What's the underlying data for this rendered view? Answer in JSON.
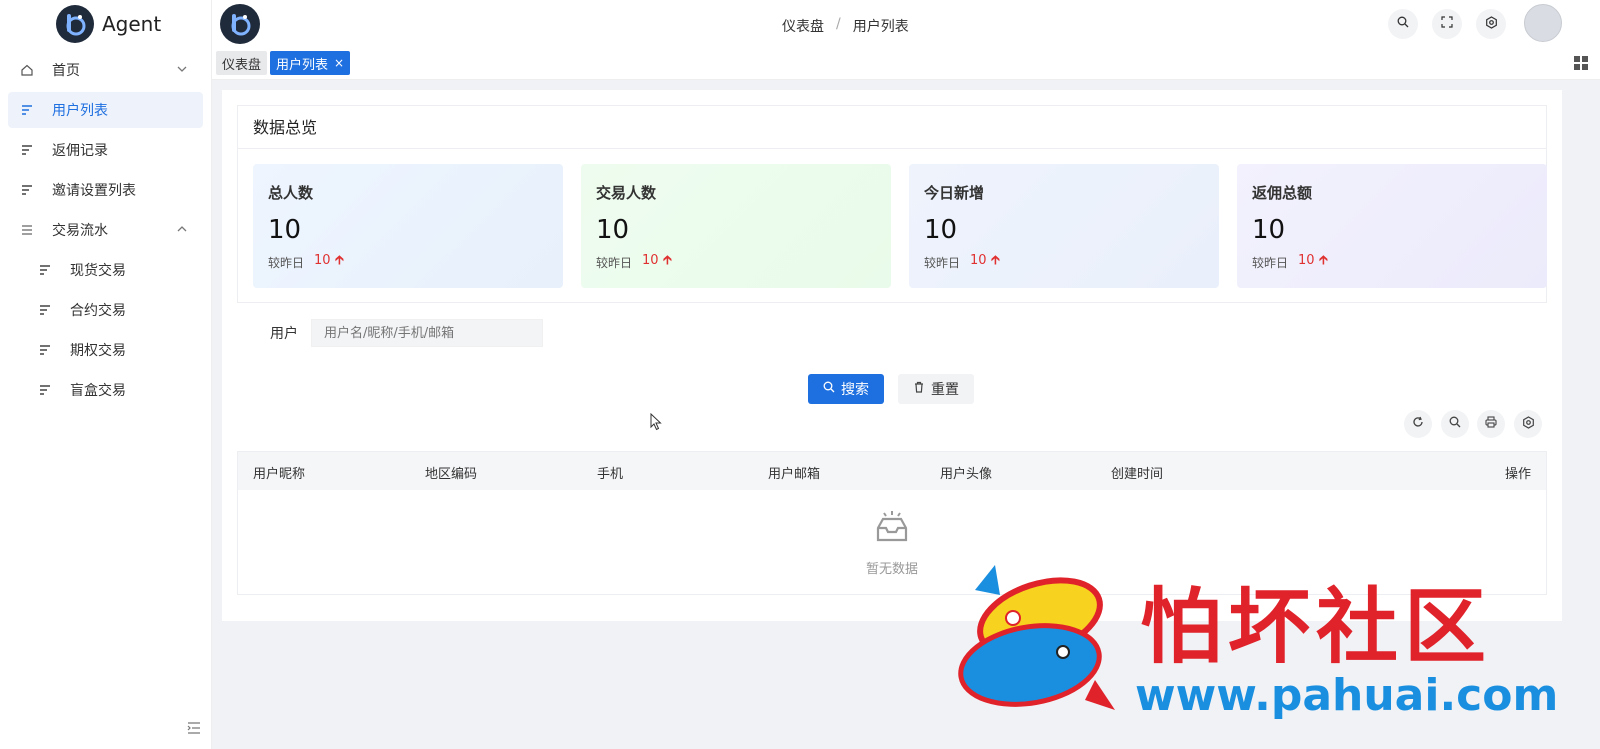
{
  "brand": {
    "name": "Agent"
  },
  "sidebar": {
    "items": [
      {
        "label": "首页",
        "icon": "home-icon"
      },
      {
        "label": "用户列表",
        "icon": "list-icon",
        "active": true
      },
      {
        "label": "返佣记录",
        "icon": "list-icon"
      },
      {
        "label": "邀请设置列表",
        "icon": "list-icon"
      },
      {
        "label": "交易流水",
        "icon": "menu-icon"
      },
      {
        "label": "现货交易",
        "icon": "list-icon"
      },
      {
        "label": "合约交易",
        "icon": "list-icon"
      },
      {
        "label": "期权交易",
        "icon": "list-icon"
      },
      {
        "label": "盲盒交易",
        "icon": "list-icon"
      }
    ]
  },
  "header": {
    "breadcrumb": [
      "仪表盘",
      "用户列表"
    ],
    "breadcrumb_sep": "/"
  },
  "tabs": [
    {
      "label": "仪表盘"
    },
    {
      "label": "用户列表",
      "close": "×"
    }
  ],
  "overview": {
    "title": "数据总览",
    "compare_label": "较昨日",
    "stats": [
      {
        "label": "总人数",
        "value": "10",
        "delta": "10"
      },
      {
        "label": "交易人数",
        "value": "10",
        "delta": "10"
      },
      {
        "label": "今日新增",
        "value": "10",
        "delta": "10"
      },
      {
        "label": "返佣总额",
        "value": "10",
        "delta": "10"
      }
    ]
  },
  "search": {
    "label": "用户",
    "placeholder": "用户名/昵称/手机/邮箱",
    "search_btn": "搜索",
    "reset_btn": "重置"
  },
  "table": {
    "columns": [
      "用户昵称",
      "地区编码",
      "手机",
      "用户邮箱",
      "用户头像",
      "创建时间",
      "操作"
    ],
    "empty_text": "暂无数据"
  },
  "watermark": {
    "title": "怕坏社区",
    "url": "www.pahuai.com"
  },
  "colors": {
    "primary": "#1e6fe0",
    "up": "#e03131",
    "watermark_red": "#e0222a",
    "watermark_blue": "#1a8fe0"
  }
}
